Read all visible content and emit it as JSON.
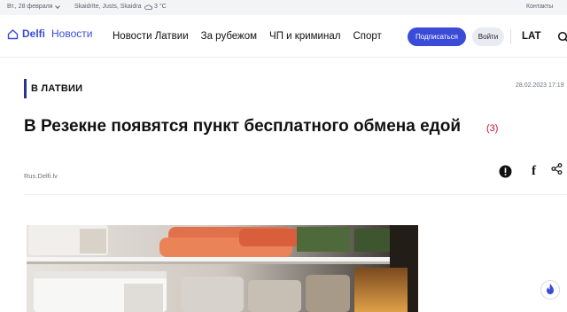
{
  "topbar": {
    "date": "Вт., 28 февраля",
    "namedays": "Skaidrīte, Justs, Skaidra",
    "weather": "3 °C",
    "contacts": "Контакты"
  },
  "header": {
    "brand": "Delfi",
    "brand_suffix": "Новости",
    "nav": [
      "Новости Латвии",
      "За рубежом",
      "ЧП и криминал",
      "Спорт"
    ],
    "subscribe_label": "Подписаться",
    "login_label": "Войти",
    "language": "LAT"
  },
  "article": {
    "category": "В ЛАТВИИ",
    "published": "28.02.2023 17:19",
    "title": "В Резекне появятся пункт бесплатного обмена едой",
    "comments": "(3)",
    "source": "Rus.Delfi.lv"
  },
  "colors": {
    "brand": "#3a4bd8",
    "category_bar": "#2e3192",
    "comments": "#c8102e"
  },
  "icons": [
    "home-icon",
    "chevron-down-icon",
    "cloud-icon",
    "search-icon",
    "report-icon",
    "facebook-icon",
    "share-icon",
    "fire-badge-icon"
  ]
}
